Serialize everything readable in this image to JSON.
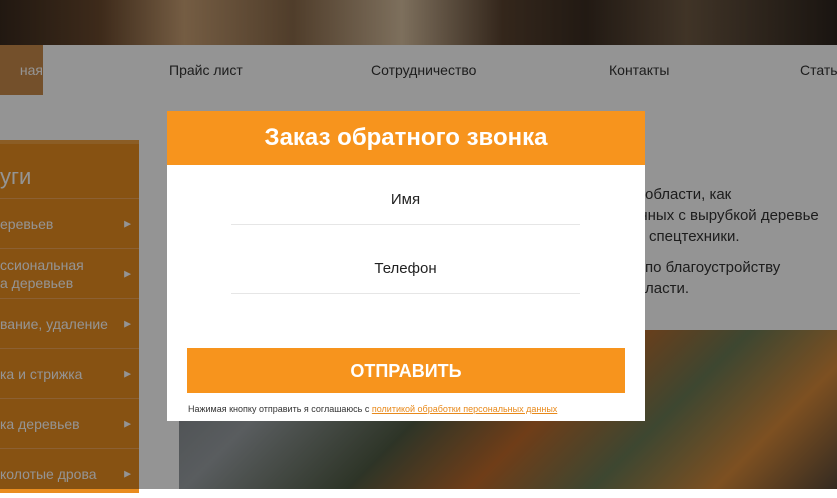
{
  "nav": {
    "items": [
      "ная",
      "Прайс лист",
      "Сотрудничество",
      "Контакты",
      "Стать"
    ]
  },
  "sidebar": {
    "title": "уги",
    "items": [
      {
        "label": "еревьев"
      },
      {
        "label": "ссиональная\nа деревьев"
      },
      {
        "label": "вание, удаление"
      },
      {
        "label": "ка и стрижка"
      },
      {
        "label": "ка деревьев"
      },
      {
        "label": "колотые дрова"
      }
    ]
  },
  "content": {
    "lines": [
      "области, как",
      "анных с вырубкой деревье",
      "спецтехники.",
      "по благоустройству",
      "ласти."
    ]
  },
  "modal": {
    "title": "Заказ обратного звонка",
    "name_placeholder": "Имя",
    "phone_placeholder": "Телефон",
    "submit_label": "ОТПРАВИТЬ",
    "consent_text": "Нажимая кнопку отправить я соглашаюсь с ",
    "consent_link": "политикой обработки персональных данных"
  },
  "colors": {
    "accent": "#f7941d",
    "sidebar": "#e98d1f"
  }
}
